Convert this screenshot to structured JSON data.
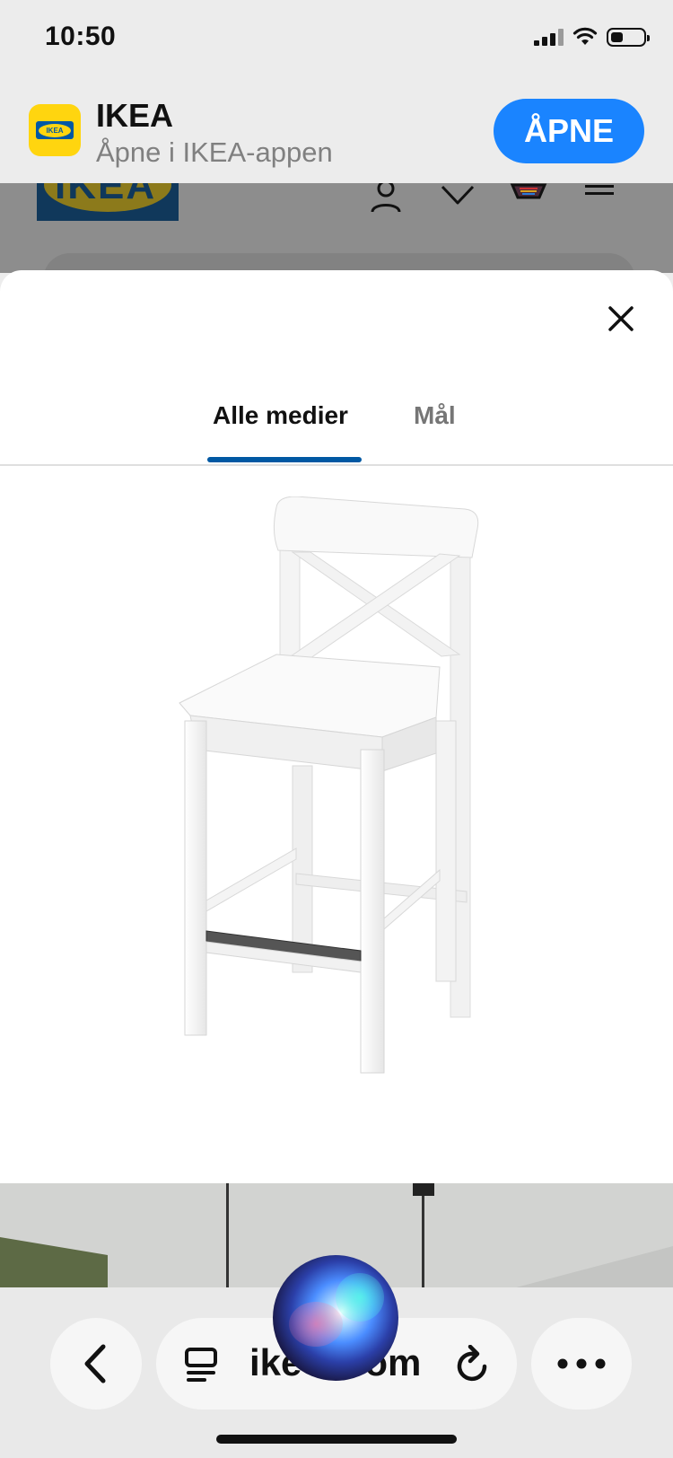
{
  "status_bar": {
    "time": "10:50"
  },
  "app_banner": {
    "app_name": "IKEA",
    "subtitle": "Åpne i IKEA-appen",
    "open_label": "ÅPNE",
    "icon_text": "IKEA",
    "brand_color": "#0058a3",
    "accent_color": "#ffd50f",
    "button_color": "#1a84ff"
  },
  "page_header": {
    "logo_text": "IKEA",
    "icons": [
      "profile-icon",
      "heart-icon",
      "cart-icon",
      "menu-icon"
    ]
  },
  "media_modal": {
    "close_icon": "close-icon",
    "tabs": [
      {
        "label": "Alle medier",
        "active": true
      },
      {
        "label": "Mål",
        "active": false
      }
    ],
    "active_tab_color": "#0058a3",
    "image": "white-bar-stool-with-backrest"
  },
  "browser": {
    "address": "ike      om",
    "icons": [
      "back-icon",
      "reader-icon",
      "reload-icon",
      "more-icon"
    ]
  },
  "siri": {
    "icon": "siri-orb"
  }
}
